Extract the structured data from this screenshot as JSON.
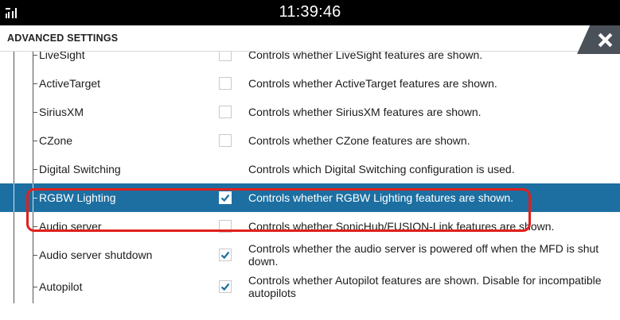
{
  "status_bar": {
    "time": "11:39:46"
  },
  "header": {
    "title": "ADVANCED SETTINGS"
  },
  "rows": [
    {
      "label": "LiveSight",
      "checked": false,
      "description": "Controls whether LiveSight features are shown."
    },
    {
      "label": "ActiveTarget",
      "checked": false,
      "description": "Controls whether ActiveTarget features are shown."
    },
    {
      "label": "SiriusXM",
      "checked": false,
      "description": "Controls whether SiriusXM features are shown."
    },
    {
      "label": "CZone",
      "checked": false,
      "description": "Controls whether CZone features are shown."
    },
    {
      "label": "Digital Switching",
      "checked": null,
      "description": "Controls which Digital Switching configuration is used."
    },
    {
      "label": "RGBW Lighting",
      "checked": true,
      "selected": true,
      "description": "Controls whether RGBW Lighting features are shown."
    },
    {
      "label": "Audio server",
      "checked": false,
      "description": "Controls whether SonicHub/FUSION-Link features are shown."
    },
    {
      "label": "Audio server shutdown",
      "checked": true,
      "description": "Controls whether the audio server is powered off when the MFD is shut down."
    },
    {
      "label": "Autopilot",
      "checked": true,
      "description": "Controls whether Autopilot features are shown. Disable for incompatible autopilots"
    }
  ],
  "colors": {
    "selected_row": "#1d6fa1",
    "highlight_border": "#e0201b",
    "check_mark": "#1d6fa1"
  },
  "icons": {
    "signal": "signal-strength-icon",
    "close": "close-icon",
    "check": "check-icon"
  }
}
